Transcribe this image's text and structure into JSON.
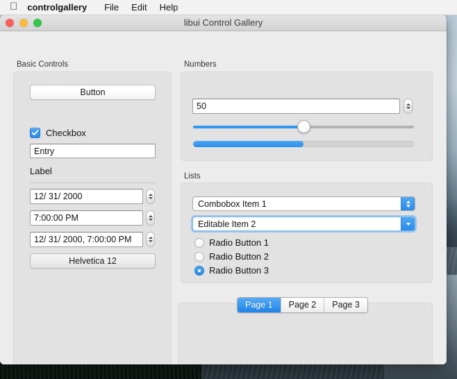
{
  "menubar": {
    "apple_icon": "apple-icon",
    "items": [
      {
        "label": "controlgallery",
        "bold": true
      },
      {
        "label": "File"
      },
      {
        "label": "Edit"
      },
      {
        "label": "Help"
      }
    ]
  },
  "window": {
    "title": "libui Control Gallery",
    "traffic_lights": [
      "close-button",
      "minimize-button",
      "zoom-button"
    ]
  },
  "basic_controls": {
    "group_label": "Basic Controls",
    "button_label": "Button",
    "checkbox": {
      "label": "Checkbox",
      "checked": true
    },
    "entry_value": "Entry",
    "entry_placeholder": "Entry",
    "label_text": "Label",
    "date_value": "12/ 31/ 2000",
    "time_value": "7:00:00 PM",
    "datetime_value": "12/ 31/ 2000,  7:00:00 PM",
    "font_button_label": "Helvetica 12"
  },
  "numbers": {
    "group_label": "Numbers",
    "spinbox_value": "50",
    "slider": {
      "value": 50,
      "min": 0,
      "max": 100
    },
    "progressbar": {
      "value": 50,
      "min": 0,
      "max": 100
    }
  },
  "lists": {
    "group_label": "Lists",
    "combobox_value": "Combobox Item 1",
    "editable_combobox_value": "Editable Item 2",
    "radios": [
      {
        "label": "Radio Button 1",
        "selected": false
      },
      {
        "label": "Radio Button 2",
        "selected": false
      },
      {
        "label": "Radio Button 3",
        "selected": true
      }
    ]
  },
  "tabs": {
    "items": [
      {
        "label": "Page 1",
        "active": true
      },
      {
        "label": "Page 2",
        "active": false
      },
      {
        "label": "Page 3",
        "active": false
      }
    ]
  },
  "colors": {
    "accent_blue": "#2b8bea",
    "window_bg": "#ececec",
    "group_bg": "#e2e2e2",
    "menubar_bg": "#f2f2f2"
  }
}
